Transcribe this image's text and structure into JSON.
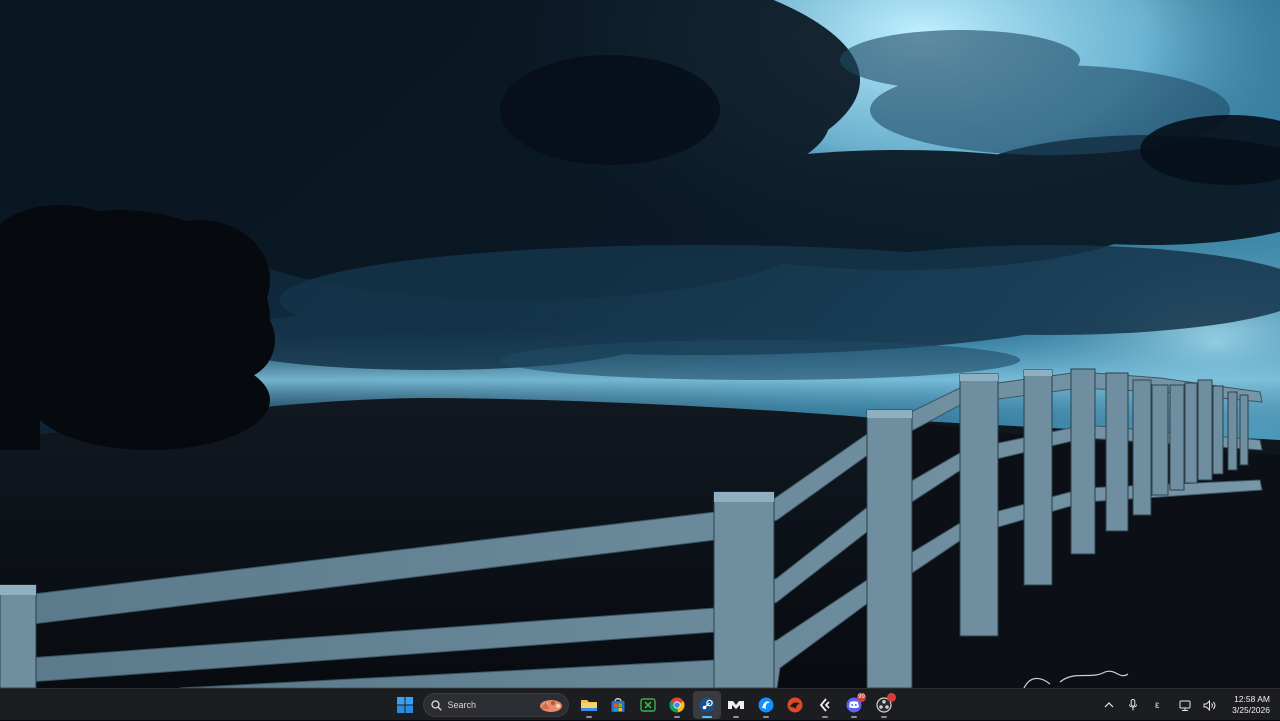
{
  "taskbar": {
    "search_label": "Search",
    "apps": [
      {
        "name": "file-explorer-icon"
      },
      {
        "name": "microsoft-store-icon"
      },
      {
        "name": "xbox-app-icon"
      },
      {
        "name": "chrome-icon"
      },
      {
        "name": "steam-icon"
      },
      {
        "name": "game-launcher-icon"
      },
      {
        "name": "battle-net-icon"
      },
      {
        "name": "red-launcher-icon"
      },
      {
        "name": "game-client-icon"
      },
      {
        "name": "discord-icon",
        "badge": "99"
      },
      {
        "name": "obs-icon",
        "badge": ""
      }
    ],
    "tray": {
      "chevron_icon": "chevron-up-icon",
      "mic_icon": "microphone-icon",
      "ime_label": "ε",
      "network_icon": "network-icon",
      "volume_icon": "volume-icon"
    },
    "clock": {
      "time": "12:58 AM",
      "date": "3/25/2026"
    },
    "accent_color": "#4cc2ff"
  },
  "wallpaper": {
    "description_colors": {
      "sky_light": "#9fdcf2",
      "cloud_dark": "#0c1b28",
      "fence": "#5f7f90"
    }
  }
}
